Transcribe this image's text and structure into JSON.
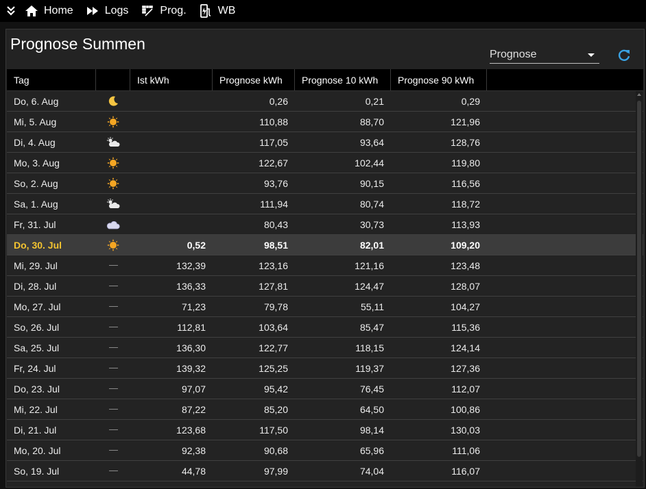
{
  "nav": {
    "items": [
      {
        "label": "Home",
        "icon": "home-icon"
      },
      {
        "label": "Logs",
        "icon": "fast-forward-icon"
      },
      {
        "label": "Prog.",
        "icon": "forecast-icon"
      },
      {
        "label": "WB",
        "icon": "charger-icon"
      }
    ]
  },
  "panel": {
    "title": "Prognose Summen",
    "select_value": "Prognose"
  },
  "table": {
    "headers": [
      "Tag",
      "",
      "Ist kWh",
      "Prognose kWh",
      "Prognose 10 kWh",
      "Prognose 90 kWh"
    ],
    "rows": [
      {
        "tag": "Do, 6. Aug",
        "weather": "moon",
        "ist": "",
        "prog": "0,26",
        "p10": "0,21",
        "p90": "0,29"
      },
      {
        "tag": "Mi, 5. Aug",
        "weather": "sun",
        "ist": "",
        "prog": "110,88",
        "p10": "88,70",
        "p90": "121,96"
      },
      {
        "tag": "Di, 4. Aug",
        "weather": "partly-cloudy",
        "ist": "",
        "prog": "117,05",
        "p10": "93,64",
        "p90": "128,76"
      },
      {
        "tag": "Mo, 3. Aug",
        "weather": "sun",
        "ist": "",
        "prog": "122,67",
        "p10": "102,44",
        "p90": "119,80"
      },
      {
        "tag": "So, 2. Aug",
        "weather": "sun",
        "ist": "",
        "prog": "93,76",
        "p10": "90,15",
        "p90": "116,56"
      },
      {
        "tag": "Sa, 1. Aug",
        "weather": "partly-cloudy",
        "ist": "",
        "prog": "111,94",
        "p10": "80,74",
        "p90": "118,72"
      },
      {
        "tag": "Fr, 31. Jul",
        "weather": "cloudy",
        "ist": "",
        "prog": "80,43",
        "p10": "30,73",
        "p90": "113,93"
      },
      {
        "tag": "Do, 30. Jul",
        "weather": "sun",
        "ist": "0,52",
        "prog": "98,51",
        "p10": "82,01",
        "p90": "109,20",
        "today": true
      },
      {
        "tag": "Mi, 29. Jul",
        "weather": "none",
        "ist": "132,39",
        "prog": "123,16",
        "p10": "121,16",
        "p90": "123,48"
      },
      {
        "tag": "Di, 28. Jul",
        "weather": "none",
        "ist": "136,33",
        "prog": "127,81",
        "p10": "124,47",
        "p90": "128,07"
      },
      {
        "tag": "Mo, 27. Jul",
        "weather": "none",
        "ist": "71,23",
        "prog": "79,78",
        "p10": "55,11",
        "p90": "104,27"
      },
      {
        "tag": "So, 26. Jul",
        "weather": "none",
        "ist": "112,81",
        "prog": "103,64",
        "p10": "85,47",
        "p90": "115,36"
      },
      {
        "tag": "Sa, 25. Jul",
        "weather": "none",
        "ist": "136,30",
        "prog": "122,77",
        "p10": "118,15",
        "p90": "124,14"
      },
      {
        "tag": "Fr, 24. Jul",
        "weather": "none",
        "ist": "139,32",
        "prog": "125,25",
        "p10": "119,37",
        "p90": "127,36"
      },
      {
        "tag": "Do, 23. Jul",
        "weather": "none",
        "ist": "97,07",
        "prog": "95,42",
        "p10": "76,45",
        "p90": "112,07"
      },
      {
        "tag": "Mi, 22. Jul",
        "weather": "none",
        "ist": "87,22",
        "prog": "85,20",
        "p10": "64,50",
        "p90": "100,86"
      },
      {
        "tag": "Di, 21. Jul",
        "weather": "none",
        "ist": "123,68",
        "prog": "117,50",
        "p10": "98,14",
        "p90": "130,03"
      },
      {
        "tag": "Mo, 20. Jul",
        "weather": "none",
        "ist": "92,38",
        "prog": "90,68",
        "p10": "65,96",
        "p90": "111,06"
      },
      {
        "tag": "So, 19. Jul",
        "weather": "none",
        "ist": "44,78",
        "prog": "97,99",
        "p10": "74,04",
        "p90": "116,07"
      }
    ]
  },
  "colors": {
    "accent_blue": "#3aa3e3",
    "today_text": "#f4c430",
    "sun": "#f5a623"
  }
}
